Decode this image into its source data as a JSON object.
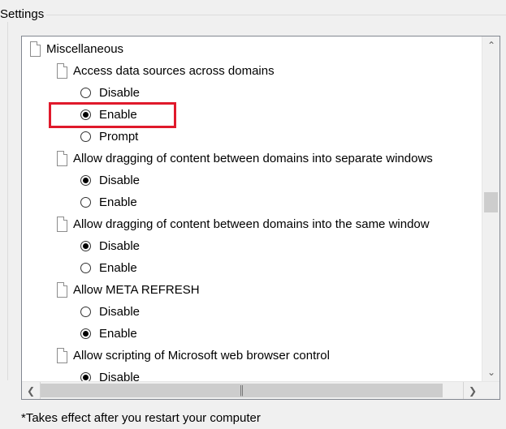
{
  "group": {
    "legend": "Settings"
  },
  "tree": {
    "nodes": [
      {
        "kind": "folder",
        "label": "Miscellaneous",
        "indent": 0
      },
      {
        "kind": "setting",
        "label": "Access data sources across domains",
        "indent": 1
      },
      {
        "kind": "option",
        "label": "Disable",
        "checked": false,
        "indent": 2
      },
      {
        "kind": "option",
        "label": "Enable",
        "checked": true,
        "indent": 2
      },
      {
        "kind": "option",
        "label": "Prompt",
        "checked": false,
        "indent": 2
      },
      {
        "kind": "setting",
        "label": "Allow dragging of content between domains into separate windows",
        "indent": 1
      },
      {
        "kind": "option",
        "label": "Disable",
        "checked": true,
        "indent": 2
      },
      {
        "kind": "option",
        "label": "Enable",
        "checked": false,
        "indent": 2
      },
      {
        "kind": "setting",
        "label": "Allow dragging of content between domains into the same window",
        "indent": 1
      },
      {
        "kind": "option",
        "label": "Disable",
        "checked": true,
        "indent": 2
      },
      {
        "kind": "option",
        "label": "Enable",
        "checked": false,
        "indent": 2
      },
      {
        "kind": "setting",
        "label": "Allow META REFRESH",
        "indent": 1
      },
      {
        "kind": "option",
        "label": "Disable",
        "checked": false,
        "indent": 2
      },
      {
        "kind": "option",
        "label": "Enable",
        "checked": true,
        "indent": 2
      },
      {
        "kind": "setting",
        "label": "Allow scripting of Microsoft web browser control",
        "indent": 1
      },
      {
        "kind": "option",
        "label": "Disable",
        "checked": true,
        "indent": 2
      }
    ]
  },
  "scrollbars": {
    "up_icon": "chevron-up-icon",
    "down_icon": "chevron-down-icon",
    "left_icon": "chevron-left-icon",
    "right_icon": "chevron-right-icon",
    "grip_icon": "grip-icon"
  },
  "highlight_color": "#e0192b",
  "footnote": "*Takes effect after you restart your computer"
}
